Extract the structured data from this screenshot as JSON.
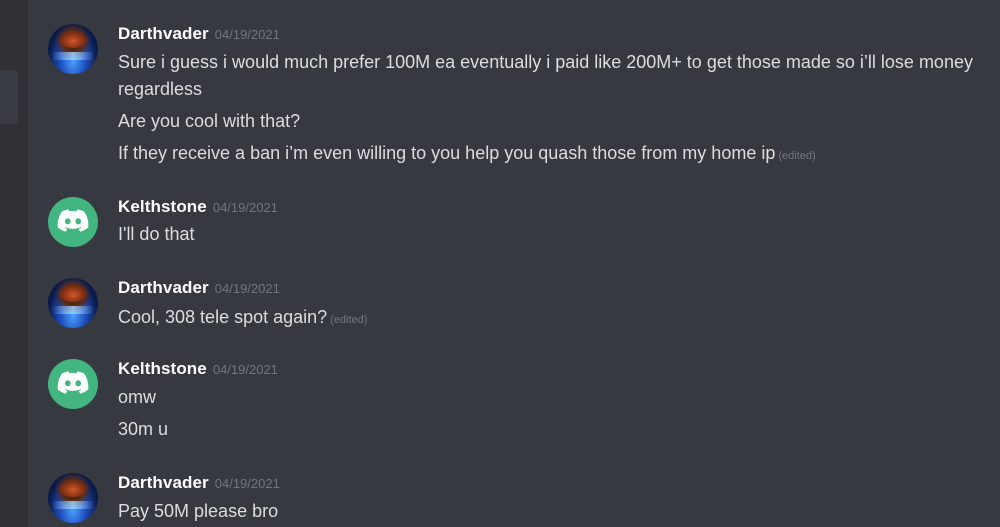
{
  "messages": [
    {
      "author": "Darthvader",
      "avatar": "vader-avatar",
      "timestamp": "04/19/2021",
      "lines": [
        {
          "text": "Sure i guess i would much prefer 100M ea eventually i paid like 200M+ to get those made so i’ll lose money regardless",
          "edited": ""
        },
        {
          "text": "Are you cool with that?",
          "edited": ""
        },
        {
          "text": "If they receive a ban i’m even willing to you help you quash those from my home ip",
          "edited": "(edited)"
        }
      ]
    },
    {
      "author": "Kelthstone",
      "avatar": "discord-default-avatar",
      "timestamp": "04/19/2021",
      "lines": [
        {
          "text": "I'll do that",
          "edited": ""
        }
      ]
    },
    {
      "author": "Darthvader",
      "avatar": "vader-avatar",
      "timestamp": "04/19/2021",
      "lines": [
        {
          "text": "Cool, 308 tele spot again?",
          "edited": "(edited)"
        }
      ]
    },
    {
      "author": "Kelthstone",
      "avatar": "discord-default-avatar",
      "timestamp": "04/19/2021",
      "lines": [
        {
          "text": "omw",
          "edited": ""
        },
        {
          "text": "30m u",
          "edited": ""
        }
      ]
    },
    {
      "author": "Darthvader",
      "avatar": "vader-avatar",
      "timestamp": "04/19/2021",
      "lines": [
        {
          "text": "Pay 50M please bro",
          "edited": ""
        }
      ]
    }
  ],
  "colors": {
    "background": "#36393f",
    "sidebar": "#2f3136",
    "username": "#ffffff",
    "message_text": "#dcddde",
    "muted": "#72767d",
    "discord_avatar": "#43b581"
  }
}
